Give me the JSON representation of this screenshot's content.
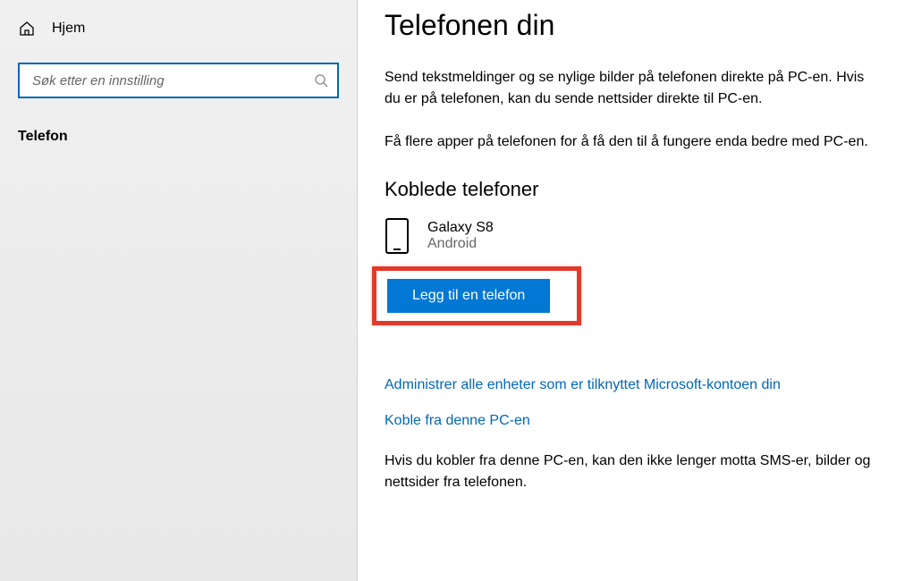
{
  "sidebar": {
    "home_label": "Hjem",
    "search_placeholder": "Søk etter en innstilling",
    "nav_item": "Telefon"
  },
  "main": {
    "title": "Telefonen din",
    "paragraph1": "Send tekstmeldinger og se nylige bilder på telefonen direkte på PC-en. Hvis du er på telefonen, kan du sende nettsider direkte til PC-en.",
    "paragraph2": "Få flere apper på telefonen for å få den til å fungere enda bedre med PC-en.",
    "linked_heading": "Koblede telefoner",
    "device": {
      "name": "Galaxy S8",
      "type": "Android"
    },
    "add_button": "Legg til en telefon",
    "manage_link": "Administrer alle enheter som er tilknyttet Microsoft-kontoen din",
    "unlink_link": "Koble fra denne PC-en",
    "unlink_desc": "Hvis du kobler fra denne PC-en, kan den ikke lenger motta SMS-er, bilder og nettsider fra telefonen."
  }
}
